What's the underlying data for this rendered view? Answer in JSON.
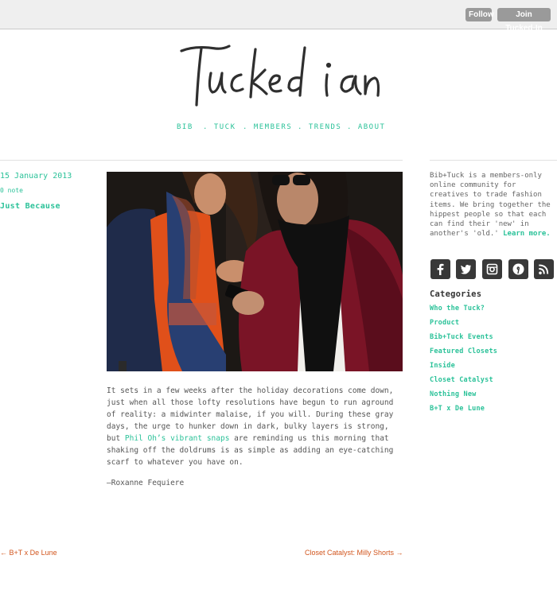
{
  "topbar": {
    "follow": "Follow",
    "join": "Join Tucked-In"
  },
  "logo_text": "Tucked in",
  "nav": [
    "BIB",
    ". TUCK",
    ". MEMBERS",
    ". TRENDS",
    ". ABOUT"
  ],
  "post": {
    "date": "15 January 2013",
    "notes": "0 note",
    "title": "Just Because",
    "body_before": "It sets in a few weeks after the holiday decorations come down, just when all those lofty resolutions have begun to run aground of reality: a midwinter malaise, if you will. During these gray days, the urge to hunker down in dark, bulky layers is strong, but ",
    "body_link": "Phil Oh’s vibrant snaps",
    "body_after": " are reminding us this morning that shaking off the doldrums is as simple as adding an eye-catching scarf to whatever you have on.",
    "signature": "—Roxanne Fequiere"
  },
  "pagination": {
    "prev": "← B+T x De Lune",
    "next": "Closet Catalyst: Milly Shorts →"
  },
  "sidebar": {
    "about": "Bib+Tuck is a members-only online community for creatives to trade fashion items. We bring together the hippest people so that each can find their 'new' in another's 'old.' ",
    "learn_more": "Learn more.",
    "social_icons": [
      "facebook-icon",
      "twitter-icon",
      "instagram-icon",
      "pinterest-icon",
      "rss-icon"
    ],
    "categories_title": "Categories",
    "categories": [
      "Who the Tuck?",
      "Product",
      "Bib+Tuck Events",
      "Featured Closets",
      "Inside",
      "Closet Catalyst",
      "Nothing New",
      "B+T x De Lune"
    ]
  },
  "colors": {
    "accent": "#2bc299",
    "link_orange": "#d2561e",
    "social_bg": "#383838"
  }
}
